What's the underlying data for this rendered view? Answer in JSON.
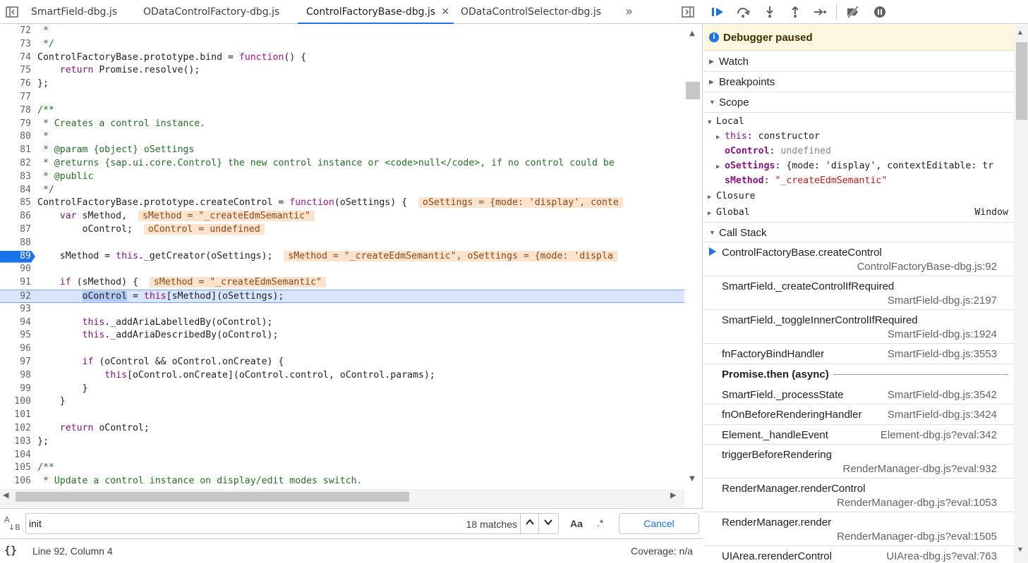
{
  "tabs": [
    {
      "label": "SmartField-dbg.js",
      "active": false
    },
    {
      "label": "ODataControlFactory-dbg.js",
      "active": false
    },
    {
      "label": "ControlFactoryBase-dbg.js",
      "active": true
    },
    {
      "label": "ODataControlSelector-dbg.js",
      "active": false
    }
  ],
  "tab_close_glyph": "✕",
  "tabs_overflow_glyph": "»",
  "code_lines": [
    {
      "n": "72",
      "html": "<span class=\"cm\"> *</span>"
    },
    {
      "n": "73",
      "html": "<span class=\"cm\"> */</span>"
    },
    {
      "n": "74",
      "html": "ControlFactoryBase.prototype.bind = <span class=\"kw\">function</span>() {"
    },
    {
      "n": "75",
      "html": "    <span class=\"kw2\">return</span> Promise.resolve();"
    },
    {
      "n": "76",
      "html": "};"
    },
    {
      "n": "77",
      "html": ""
    },
    {
      "n": "78",
      "html": "<span class=\"cm\">/**</span>"
    },
    {
      "n": "79",
      "html": "<span class=\"cm\"> * Creates a control instance.</span>"
    },
    {
      "n": "80",
      "html": "<span class=\"cm\"> *</span>"
    },
    {
      "n": "81",
      "html": "<span class=\"cm\"> * @param {object} oSettings</span>"
    },
    {
      "n": "82",
      "html": "<span class=\"cm\"> * @returns {sap.ui.core.Control} the new control instance or &lt;code&gt;null&lt;/code&gt;, if no control could be</span>"
    },
    {
      "n": "83",
      "html": "<span class=\"cm\"> * @public</span>"
    },
    {
      "n": "84",
      "html": "<span class=\"cm\"> */</span>"
    },
    {
      "n": "85",
      "html": "ControlFactoryBase.prototype.createControl = <span class=\"kw\">function</span>(oSettings) {  <span class=\"inl\">oSettings = {mode: 'display', conte</span>"
    },
    {
      "n": "86",
      "html": "    <span class=\"kw2\">var</span> sMethod,  <span class=\"inl\">sMethod = \"_createEdmSemantic\"</span>"
    },
    {
      "n": "87",
      "html": "        oControl;  <span class=\"inl\">oControl = undefined</span>"
    },
    {
      "n": "88",
      "html": ""
    },
    {
      "n": "89",
      "html": "    sMethod = <span class=\"kw2\">this</span>._getCreator(oSettings);  <span class=\"inl\">sMethod = \"_createEdmSemantic\", oSettings = {mode: 'displa</span>",
      "breakpoint": true
    },
    {
      "n": "90",
      "html": ""
    },
    {
      "n": "91",
      "html": "    <span class=\"kw2\">if</span> (sMethod) {  <span class=\"inl\">sMethod = \"_createEdmSemantic\"</span>"
    },
    {
      "n": "92",
      "html": "        <span class=\"hl\">oControl</span> = <span class=\"kw2\">this</span>[sMethod](oSettings);",
      "current": true
    },
    {
      "n": "93",
      "html": ""
    },
    {
      "n": "94",
      "html": "        <span class=\"kw2\">this</span>._addAriaLabelledBy(oControl);"
    },
    {
      "n": "95",
      "html": "        <span class=\"kw2\">this</span>._addAriaDescribedBy(oControl);"
    },
    {
      "n": "96",
      "html": ""
    },
    {
      "n": "97",
      "html": "        <span class=\"kw2\">if</span> (oControl &amp;&amp; oControl.onCreate) {"
    },
    {
      "n": "98",
      "html": "            <span class=\"kw2\">this</span>[oControl.onCreate](oControl.control, oControl.params);"
    },
    {
      "n": "99",
      "html": "        }"
    },
    {
      "n": "100",
      "html": "    }"
    },
    {
      "n": "101",
      "html": ""
    },
    {
      "n": "102",
      "html": "    <span class=\"kw2\">return</span> oControl;"
    },
    {
      "n": "103",
      "html": "};"
    },
    {
      "n": "104",
      "html": ""
    },
    {
      "n": "105",
      "html": "<span class=\"cm\">/**</span>"
    },
    {
      "n": "106",
      "html": "<span class=\"cm\"> * Update a control instance on display/edit modes switch.</span>"
    }
  ],
  "search": {
    "value": "init",
    "matches": "18 matches",
    "match_case": "Aa",
    "regex": ".*",
    "cancel": "Cancel",
    "icon_top": "A",
    "icon_bottom": "↓B"
  },
  "status": {
    "pretty_print": "{}",
    "cursor": "Line 92, Column 4",
    "coverage": "Coverage: n/a"
  },
  "debugger": {
    "paused": "Debugger paused",
    "info_glyph": "i",
    "panes": {
      "watch": "Watch",
      "breakpoints": "Breakpoints",
      "scope": "Scope",
      "call_stack": "Call Stack"
    },
    "scope": {
      "local": "Local",
      "this_name": "this",
      "this_value": "constructor",
      "ocontrol_name": "oControl",
      "ocontrol_value": "undefined",
      "osettings_name": "oSettings",
      "osettings_value": "{mode: 'display', contextEditable: tr",
      "smethod_name": "sMethod",
      "smethod_value": "\"_createEdmSemantic\"",
      "closure": "Closure",
      "global": "Global",
      "global_value": "Window"
    },
    "call_stack": [
      {
        "fn": "ControlFactoryBase.createControl",
        "loc": "ControlFactoryBase-dbg.js:92",
        "current": true,
        "two_line": true
      },
      {
        "fn": "SmartField._createControlIfRequired",
        "loc": "SmartField-dbg.js:2197",
        "two_line": true
      },
      {
        "fn": "SmartField._toggleInnerControlIfRequired",
        "loc": "SmartField-dbg.js:1924",
        "two_line": true
      },
      {
        "fn": "fnFactoryBindHandler",
        "loc": "SmartField-dbg.js:3553",
        "two_line": false
      },
      {
        "async": "Promise.then (async)"
      },
      {
        "fn": "SmartField._processState",
        "loc": "SmartField-dbg.js:3542",
        "two_line": false
      },
      {
        "fn": "fnOnBeforeRenderingHandler",
        "loc": "SmartField-dbg.js:3424",
        "two_line": false
      },
      {
        "fn": "Element._handleEvent",
        "loc": "Element-dbg.js?eval:342",
        "two_line": false
      },
      {
        "fn": "triggerBeforeRendering",
        "loc": "RenderManager-dbg.js?eval:932",
        "two_line": true
      },
      {
        "fn": "RenderManager.renderControl",
        "loc": "RenderManager-dbg.js?eval:1053",
        "two_line": true
      },
      {
        "fn": "RenderManager.render",
        "loc": "RenderManager-dbg.js?eval:1505",
        "two_line": true
      },
      {
        "fn": "UIArea.rerenderControl",
        "loc": "UIArea-dbg.js?eval:763",
        "two_line": false
      }
    ]
  },
  "colors": {
    "accent": "#1a73e8",
    "paused_banner": "#fef7e0",
    "inline_value_bg": "#fbe3ce"
  }
}
